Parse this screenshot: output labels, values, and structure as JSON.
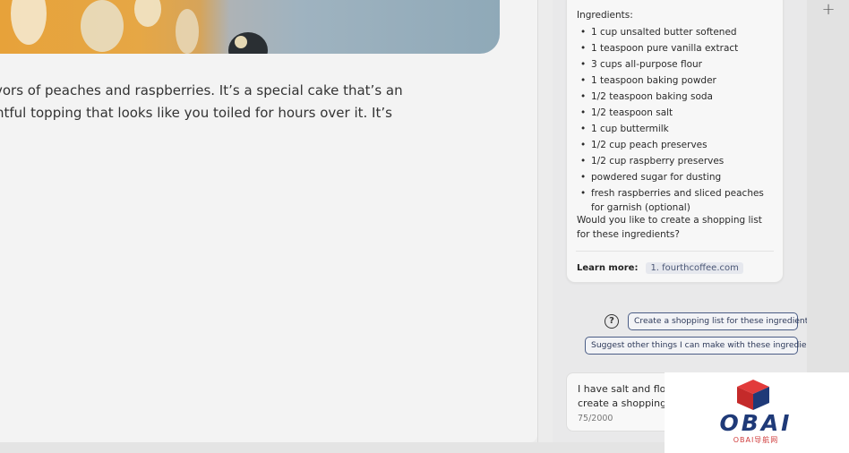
{
  "article": {
    "line1": "vors of peaches and raspberries. It’s a special cake that’s an",
    "line2": "htful topping that looks like you toiled for hours over it. It’s"
  },
  "chat": {
    "ingredients_heading": "Ingredients:",
    "ingredients": [
      "1 cup unsalted butter softened",
      "1 teaspoon pure vanilla extract",
      "3 cups all-purpose flour",
      "1 teaspoon baking powder",
      "1/2 teaspoon baking soda",
      "1/2 teaspoon salt",
      "1 cup buttermilk",
      "1/2 cup peach preserves",
      "1/2 cup raspberry preserves",
      "powdered sugar for dusting",
      "fresh raspberries and sliced peaches for garnish (optional)"
    ],
    "followup_question": "Would you like to create a shopping list for these ingredients?",
    "learn_more_label": "Learn more:",
    "learn_more_link": "1. fourthcoffee.com",
    "suggestions": [
      "Create a shopping list for these ingredients.",
      "Suggest other things I can make with these ingredients."
    ],
    "input": {
      "line1": "I have salt and flou",
      "line2": "create a shopping l",
      "char_count": "75/2000"
    }
  },
  "toolbar": {
    "plus_label": "+"
  },
  "watermark": {
    "logo_text": "OBAI",
    "logo_subtext": "OBAI导航网"
  },
  "colors": {
    "accent_border": "#4b5d86",
    "logo_blue": "#1f3a78",
    "logo_red": "#d03c3c"
  }
}
